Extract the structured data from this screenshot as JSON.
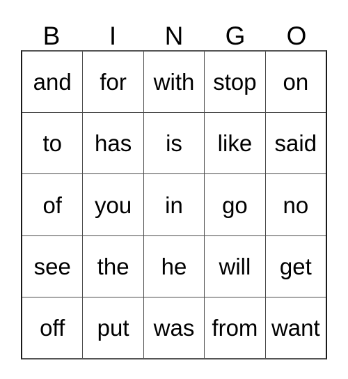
{
  "card": {
    "title": "BINGO",
    "headers": [
      "B",
      "I",
      "N",
      "G",
      "O"
    ],
    "colors": {
      "background": "#ffffff",
      "text": "#000000",
      "grid_line": "#4a4a4a",
      "outer_border": "#1a1a1a"
    },
    "rows": [
      {
        "cells": [
          "and",
          "for",
          "with",
          "stop",
          "on"
        ]
      },
      {
        "cells": [
          "to",
          "has",
          "is",
          "like",
          "said"
        ]
      },
      {
        "cells": [
          "of",
          "you",
          "in",
          "go",
          "no"
        ]
      },
      {
        "cells": [
          "see",
          "the",
          "he",
          "will",
          "get"
        ]
      },
      {
        "cells": [
          "off",
          "put",
          "was",
          "from",
          "want"
        ]
      }
    ]
  }
}
